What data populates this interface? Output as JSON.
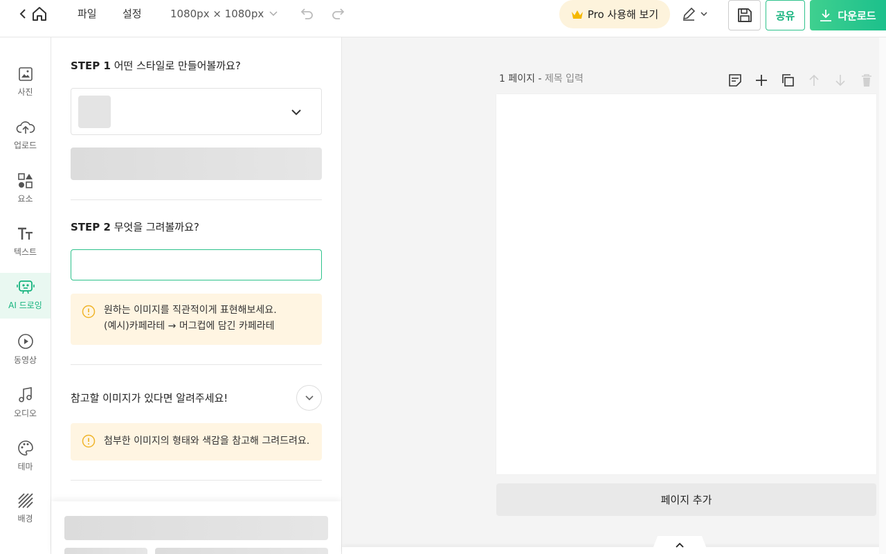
{
  "topbar": {
    "menu_file": "파일",
    "menu_settings": "설정",
    "canvas_size": "1080px × 1080px",
    "pro_label": "Pro 사용해 보기",
    "share_label": "공유",
    "download_label": "다운로드",
    "accent_color": "#1cc08c"
  },
  "rail": {
    "items": [
      {
        "label": "사진",
        "icon": "photo-icon"
      },
      {
        "label": "업로드",
        "icon": "upload-icon"
      },
      {
        "label": "요소",
        "icon": "elements-icon"
      },
      {
        "label": "텍스트",
        "icon": "text-icon"
      },
      {
        "label": "AI 드로잉",
        "icon": "ai-drawing-icon",
        "active": true
      },
      {
        "label": "동영상",
        "icon": "video-icon"
      },
      {
        "label": "오디오",
        "icon": "audio-icon"
      },
      {
        "label": "테마",
        "icon": "palette-icon"
      },
      {
        "label": "배경",
        "icon": "background-icon"
      }
    ]
  },
  "panel": {
    "step1": {
      "num": "STEP 1",
      "question": "어떤 스타일로 만들어볼까요?"
    },
    "step2": {
      "num": "STEP 2",
      "question": "무엇을 그려볼까요?",
      "input_value": ""
    },
    "notice1": {
      "line1": "원하는 이미지를 직관적이게 표현해보세요.",
      "line2": "(예시)카페라테 → 머그컵에 담긴 카페라테"
    },
    "reference": {
      "label": "참고할 이미지가 있다면 알려주세요!"
    },
    "notice2": {
      "line1": "첨부한 이미지의 형태와 색감을 참고해 그려드려요."
    }
  },
  "canvas": {
    "page_number": "1 페이지",
    "separator": " - ",
    "page_title_placeholder": "제목 입력",
    "add_page_label": "페이지 추가"
  }
}
